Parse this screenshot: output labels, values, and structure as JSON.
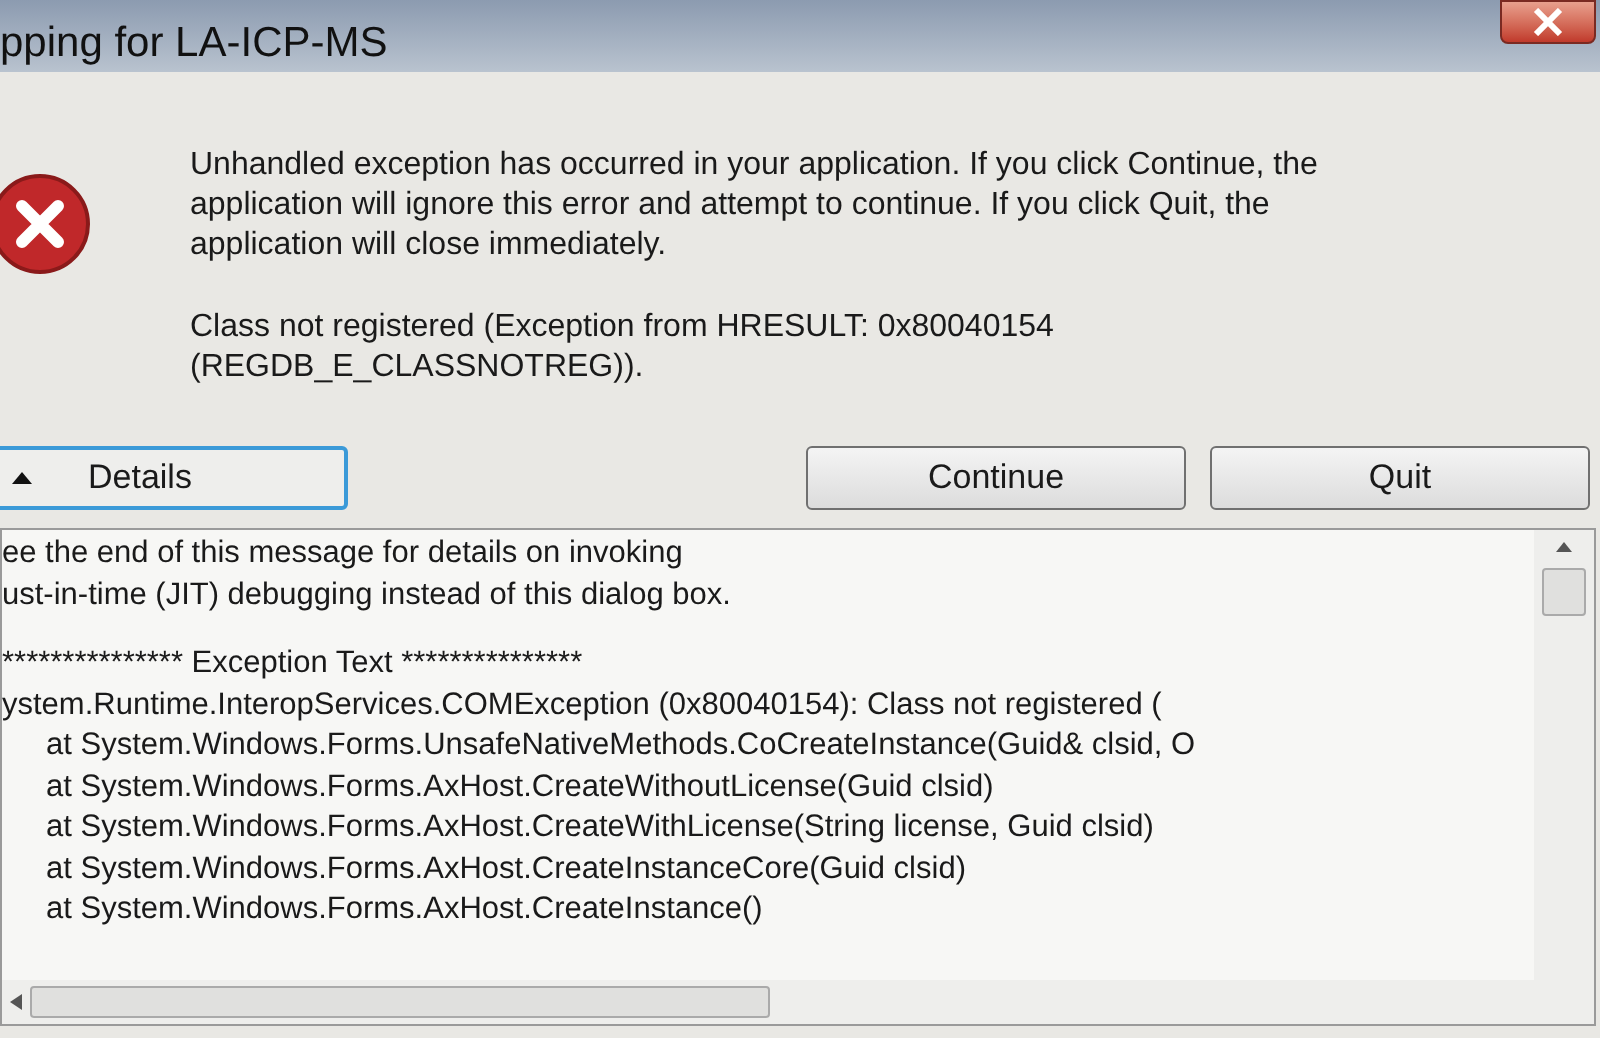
{
  "window": {
    "title": "pping for LA-ICP-MS"
  },
  "message": "Unhandled exception has occurred in your application. If you click Continue, the application will ignore this error and attempt to continue. If you click Quit, the application will close immediately.",
  "error_detail": "Class not registered (Exception from HRESULT: 0x80040154 (REGDB_E_CLASSNOTREG)).",
  "details_button": {
    "label": "Details",
    "expanded": true
  },
  "buttons": [
    {
      "label": "Continue"
    },
    {
      "label": "Quit"
    }
  ],
  "details_text": {
    "intro": [
      "ee the end of this message for details on invoking",
      "ust-in-time (JIT) debugging instead of this dialog box."
    ],
    "lines": [
      {
        "text": "*************** Exception Text ***************",
        "indent": false
      },
      {
        "text": "ystem.Runtime.InteropServices.COMException (0x80040154): Class not registered (",
        "indent": false
      },
      {
        "text": "at System.Windows.Forms.UnsafeNativeMethods.CoCreateInstance(Guid& clsid, O",
        "indent": true
      },
      {
        "text": "at System.Windows.Forms.AxHost.CreateWithoutLicense(Guid clsid)",
        "indent": true
      },
      {
        "text": "at System.Windows.Forms.AxHost.CreateWithLicense(String license, Guid clsid)",
        "indent": true
      },
      {
        "text": "at System.Windows.Forms.AxHost.CreateInstanceCore(Guid clsid)",
        "indent": true
      },
      {
        "text": "at System.Windows.Forms.AxHost.CreateInstance()",
        "indent": true
      }
    ]
  }
}
